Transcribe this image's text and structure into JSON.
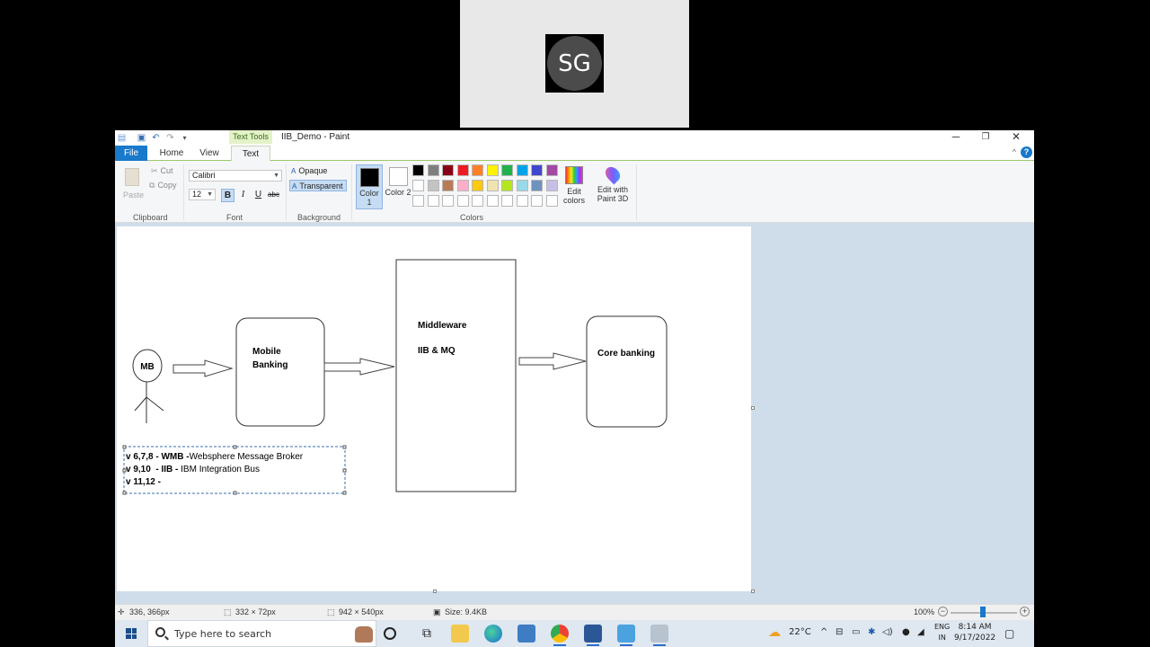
{
  "call": {
    "initials": "SG"
  },
  "window": {
    "title": "IIB_Demo - Paint",
    "context_tab": "Text Tools",
    "controls": {
      "minimize": "─",
      "restore": "❐",
      "close": "✕"
    }
  },
  "tabs": {
    "file": "File",
    "home": "Home",
    "view": "View",
    "text": "Text"
  },
  "help": "?",
  "ribbon": {
    "clipboard": {
      "paste": "Paste",
      "cut": "Cut",
      "copy": "Copy",
      "group": "Clipboard"
    },
    "font": {
      "family": "Calibri",
      "size": "12",
      "bold": "B",
      "italic": "I",
      "underline": "U",
      "strike": "abc",
      "group": "Font"
    },
    "background": {
      "opaque": "Opaque",
      "transparent": "Transparent",
      "group": "Background"
    },
    "colors": {
      "color1": "Color 1",
      "color2": "Color 2",
      "color1_value": "#000000",
      "color2_value": "#ffffff",
      "group": "Colors",
      "palette_row1": [
        "#000000",
        "#7f7f7f",
        "#880015",
        "#ed1c24",
        "#ff7f27",
        "#fff200",
        "#22b14c",
        "#00a2e8",
        "#3f48cc",
        "#a349a4"
      ],
      "palette_row2": [
        "#ffffff",
        "#c3c3c3",
        "#b97a57",
        "#ffaec9",
        "#ffc90e",
        "#efe4b0",
        "#b5e61d",
        "#99d9ea",
        "#7092be",
        "#c8bfe7"
      ],
      "palette_row3": [
        "#ffffff",
        "#ffffff",
        "#ffffff",
        "#ffffff",
        "#ffffff",
        "#ffffff",
        "#ffffff",
        "#ffffff",
        "#ffffff",
        "#ffffff"
      ]
    },
    "edit_colors": "Edit colors",
    "edit_paint3d": "Edit with Paint 3D"
  },
  "diagram": {
    "actor": "MB",
    "mobile_banking": [
      "Mobile",
      "Banking"
    ],
    "middleware": "Middleware",
    "iib_mq": "IIB & MQ",
    "core_banking": "Core banking",
    "notes": [
      {
        "bold": "v 6,7,8 - WMB -",
        "normal": "Websphere Message Broker"
      },
      {
        "bold": "v 9,10  - IIB -",
        "normal": " IBM Integration Bus"
      },
      {
        "bold": "v 11,12 -",
        "normal": ""
      }
    ]
  },
  "status": {
    "cursor": "336, 366px",
    "selection": "332 × 72px",
    "canvas_size": "942 × 540px",
    "file_size": "Size: 9.4KB",
    "zoom": "100%"
  },
  "taskbar": {
    "search_placeholder": "Type here to search",
    "weather": "22°C",
    "lang": "ENG",
    "region": "IN",
    "time": "8:14 AM",
    "date": "9/17/2022"
  }
}
